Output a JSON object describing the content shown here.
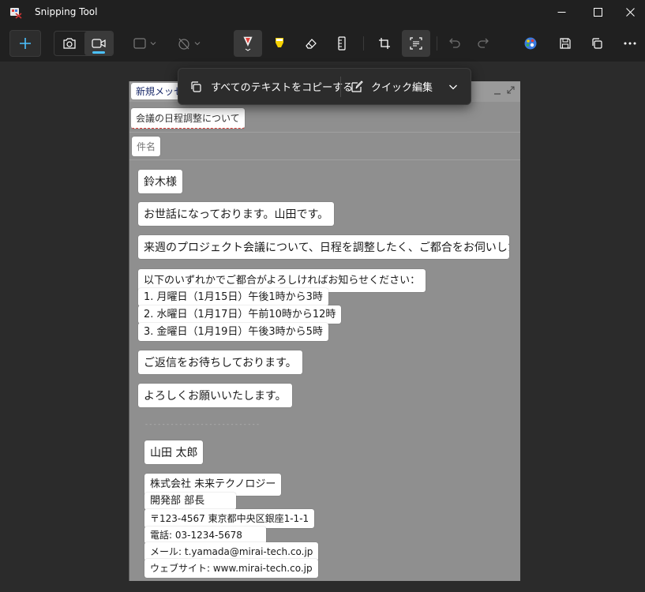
{
  "app": {
    "title": "Snipping Tool"
  },
  "colors": {
    "accent": "#4cc2ff",
    "pen_red": "#e0403a",
    "highlighter_yellow": "#f5d000"
  },
  "toolbar": {
    "icons": [
      "plus-icon",
      "camera-icon",
      "video-icon",
      "rectangle-snip-icon",
      "timer-icon",
      "pen-icon",
      "highlighter-icon",
      "eraser-icon",
      "ruler-icon",
      "crop-icon",
      "text-actions-icon",
      "undo-icon",
      "redo-icon",
      "paint-icon",
      "save-icon",
      "copy-icon",
      "more-icon"
    ]
  },
  "popup": {
    "copy_all_text": "すべてのテキストをコピーする",
    "quick_edit": "クイック編集"
  },
  "email": {
    "header_label": "新規メッセ",
    "subject_value": "会議の日程調整について",
    "subject_placeholder": "件名",
    "greeting": "鈴木様",
    "intro": "お世話になっております。山田です。",
    "purpose": "来週のプロジェクト会議について、日程を調整したく、ご都合をお伺いした",
    "options_intro": "以下のいずれかでご都合がよろしければお知らせください：",
    "option1": "1. 月曜日（1月15日）午後1時から3時",
    "option2": "2. 水曜日（1月17日）午前10時から12時",
    "option3": "3. 金曜日（1月19日）午後3時から5時",
    "await_reply": "ご返信をお待ちしております。",
    "closing": "よろしくお願いいたします。",
    "separator": "- - - - - - - - - - - - - - - - - - - - - - - - - - -",
    "signature": {
      "name": "山田 太郎",
      "company": "株式会社 未来テクノロジー",
      "department": "開発部 部長",
      "address": "〒123-4567 東京都中央区銀座1-1-1",
      "phone": "電話: 03-1234-5678",
      "email": "メール: t.yamada@mirai-tech.co.jp",
      "website": "ウェブサイト: www.mirai-tech.co.jp"
    }
  }
}
